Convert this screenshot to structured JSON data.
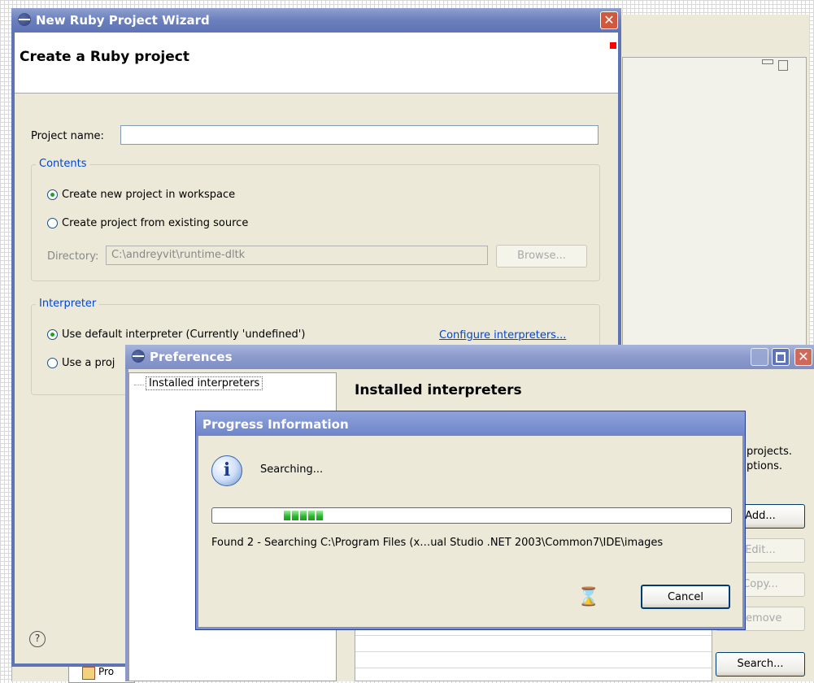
{
  "wizard": {
    "title": "New Ruby Project Wizard",
    "close_glyph": "✕",
    "header_title": "Create a Ruby project",
    "project_name_label": "Project name:",
    "project_name_value": "",
    "contents_group": "Contents",
    "radio_new_workspace": "Create new project in workspace",
    "radio_existing_source": "Create project from existing source",
    "directory_label": "Directory:",
    "directory_value": "C:\\andreyvit\\runtime-dltk",
    "browse_button": "Browse...",
    "interpreter_group": "Interpreter",
    "radio_default_interpreter": "Use default interpreter (Currently 'undefined')",
    "configure_link": "Configure interpreters...",
    "radio_project_interpreter_partial": "Use a proj",
    "help_glyph": "?"
  },
  "preferences": {
    "title": "Preferences",
    "tree_item": "Installed interpreters",
    "page_title": "Installed interpreters",
    "desc_line1_partial": "projects.",
    "desc_line2_partial": "ptions.",
    "buttons": {
      "add": "Add...",
      "edit": "Edit...",
      "copy": "Copy...",
      "remove": "Remove",
      "search": "Search..."
    }
  },
  "progress": {
    "title": "Progress Information",
    "message": "Searching...",
    "status": "Found 2 - Searching C:\\Program Files (x…ual Studio .NET 2003\\Common7\\IDE\\images",
    "cancel_button": "Cancel",
    "bar_segments": 5
  },
  "background": {
    "project_item_partial": "Pro"
  }
}
